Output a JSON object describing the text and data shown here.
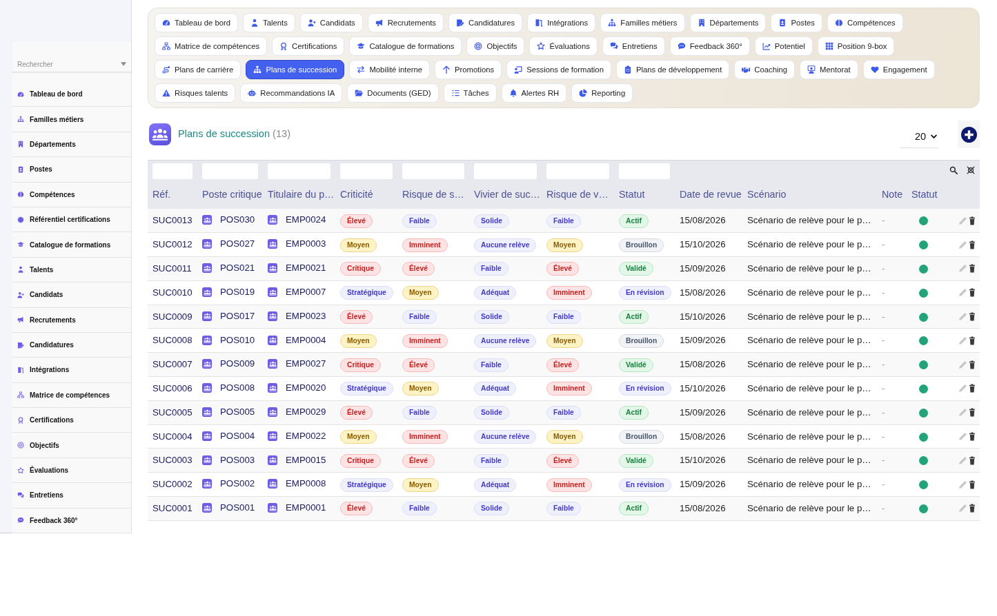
{
  "sidebar": {
    "search": {
      "placeholder": "Rechercher"
    },
    "items": [
      "Tableau de bord",
      "Familles métiers",
      "Départements",
      "Postes",
      "Compétences",
      "Référentiel certifications",
      "Catalogue de formations",
      "Talents",
      "Candidats",
      "Recrutements",
      "Candidatures",
      "Intégrations",
      "Matrice de compétences",
      "Certifications",
      "Objectifs",
      "Évaluations",
      "Entretiens",
      "Feedback 360°"
    ]
  },
  "nav": {
    "items": [
      {
        "label": "Tableau de bord",
        "selected": false
      },
      {
        "label": "Talents",
        "selected": false
      },
      {
        "label": "Candidats",
        "selected": false
      },
      {
        "label": "Recrutements",
        "selected": false
      },
      {
        "label": "Candidatures",
        "selected": false
      },
      {
        "label": "Intégrations",
        "selected": false
      },
      {
        "label": "Familles métiers",
        "selected": false
      },
      {
        "label": "Départements",
        "selected": false
      },
      {
        "label": "Postes",
        "selected": false
      },
      {
        "label": "Compétences",
        "selected": false
      },
      {
        "label": "Matrice de compétences",
        "selected": false
      },
      {
        "label": "Certifications",
        "selected": false
      },
      {
        "label": "Catalogue de formations",
        "selected": false
      },
      {
        "label": "Objectifs",
        "selected": false
      },
      {
        "label": "Évaluations",
        "selected": false
      },
      {
        "label": "Entretiens",
        "selected": false
      },
      {
        "label": "Feedback 360°",
        "selected": false
      },
      {
        "label": "Potentiel",
        "selected": false
      },
      {
        "label": "Position 9-box",
        "selected": false
      },
      {
        "label": "Plans de carrière",
        "selected": false
      },
      {
        "label": "Plans de succession",
        "selected": true
      },
      {
        "label": "Mobilité interne",
        "selected": false
      },
      {
        "label": "Promotions",
        "selected": false
      },
      {
        "label": "Sessions de formation",
        "selected": false
      },
      {
        "label": "Plans de développement",
        "selected": false
      },
      {
        "label": "Coaching",
        "selected": false
      },
      {
        "label": "Mentorat",
        "selected": false
      },
      {
        "label": "Engagement",
        "selected": false
      },
      {
        "label": "Risques talents",
        "selected": false
      },
      {
        "label": "Recommandations IA",
        "selected": false
      },
      {
        "label": "Documents (GED)",
        "selected": false
      },
      {
        "label": "Tâches",
        "selected": false
      },
      {
        "label": "Alertes RH",
        "selected": false
      },
      {
        "label": "Reporting",
        "selected": false
      }
    ]
  },
  "header": {
    "title": "Plans de succession",
    "count": "(13)",
    "page_size": "20"
  },
  "table": {
    "columns": [
      {
        "label": "Réf.",
        "filter": true
      },
      {
        "label": "Poste critique",
        "filter": true
      },
      {
        "label": "Titulaire du p…",
        "filter": true
      },
      {
        "label": "Criticité",
        "filter": true
      },
      {
        "label": "Risque de s…",
        "filter": true
      },
      {
        "label": "Vivier de suc…",
        "filter": true
      },
      {
        "label": "Risque de v…",
        "filter": true
      },
      {
        "label": "Statut",
        "filter": true
      },
      {
        "label": "Date de revue",
        "filter": false
      },
      {
        "label": "Scénario",
        "filter": false
      },
      {
        "label": "Note",
        "filter": false
      },
      {
        "label": "Statut",
        "filter": false
      }
    ],
    "rows": [
      {
        "cells": [
          {
            "kind": "ref",
            "text": "SUC0013"
          },
          {
            "kind": "record",
            "text": "POS030"
          },
          {
            "kind": "record",
            "text": "EMP0024"
          },
          {
            "kind": "badge",
            "text": "Élevé",
            "color": "#c81e1e"
          },
          {
            "kind": "badge",
            "text": "Faible",
            "color": "#4338ca"
          },
          {
            "kind": "badge",
            "text": "Solide",
            "color": "#4338ca"
          },
          {
            "kind": "badge",
            "text": "Faible",
            "color": "#4338ca"
          },
          {
            "kind": "badge",
            "text": "Actif",
            "color": "#15803d"
          },
          {
            "kind": "text",
            "text": "15/08/2026"
          },
          {
            "kind": "text",
            "text": "Scénario de relève pour le p…"
          },
          {
            "kind": "muted",
            "text": "-"
          },
          {
            "kind": "dot",
            "color": "#22a37a"
          }
        ]
      },
      {
        "cells": [
          {
            "kind": "ref",
            "text": "SUC0012"
          },
          {
            "kind": "record",
            "text": "POS027"
          },
          {
            "kind": "record",
            "text": "EMP0003"
          },
          {
            "kind": "badge",
            "text": "Moyen",
            "color": "#8a5a00"
          },
          {
            "kind": "badge",
            "text": "Imminent",
            "color": "#c81e1e"
          },
          {
            "kind": "badge",
            "text": "Aucune relève",
            "color": "#4338ca"
          },
          {
            "kind": "badge",
            "text": "Moyen",
            "color": "#8a5a00"
          },
          {
            "kind": "badge",
            "text": "Brouillon",
            "color": "#475569"
          },
          {
            "kind": "text",
            "text": "15/10/2026"
          },
          {
            "kind": "text",
            "text": "Scénario de relève pour le p…"
          },
          {
            "kind": "muted",
            "text": "-"
          },
          {
            "kind": "dot",
            "color": "#22a37a"
          }
        ]
      },
      {
        "cells": [
          {
            "kind": "ref",
            "text": "SUC0011"
          },
          {
            "kind": "record",
            "text": "POS021"
          },
          {
            "kind": "record",
            "text": "EMP0021"
          },
          {
            "kind": "badge",
            "text": "Critique",
            "color": "#c81e1e"
          },
          {
            "kind": "badge",
            "text": "Élevé",
            "color": "#c81e1e"
          },
          {
            "kind": "badge",
            "text": "Faible",
            "color": "#4338ca"
          },
          {
            "kind": "badge",
            "text": "Élevé",
            "color": "#c81e1e"
          },
          {
            "kind": "badge",
            "text": "Validé",
            "color": "#15803d"
          },
          {
            "kind": "text",
            "text": "15/09/2026"
          },
          {
            "kind": "text",
            "text": "Scénario de relève pour le p…"
          },
          {
            "kind": "muted",
            "text": "-"
          },
          {
            "kind": "dot",
            "color": "#22a37a"
          }
        ]
      },
      {
        "cells": [
          {
            "kind": "ref",
            "text": "SUC0010"
          },
          {
            "kind": "record",
            "text": "POS019"
          },
          {
            "kind": "record",
            "text": "EMP0007"
          },
          {
            "kind": "badge",
            "text": "Stratégique",
            "color": "#4338ca"
          },
          {
            "kind": "badge",
            "text": "Moyen",
            "color": "#8a5a00"
          },
          {
            "kind": "badge",
            "text": "Adéquat",
            "color": "#4338ca"
          },
          {
            "kind": "badge",
            "text": "Imminent",
            "color": "#c81e1e"
          },
          {
            "kind": "badge",
            "text": "En révision",
            "color": "#4338ca"
          },
          {
            "kind": "text",
            "text": "15/08/2026"
          },
          {
            "kind": "text",
            "text": "Scénario de relève pour le p…"
          },
          {
            "kind": "muted",
            "text": "-"
          },
          {
            "kind": "dot",
            "color": "#22a37a"
          }
        ]
      },
      {
        "cells": [
          {
            "kind": "ref",
            "text": "SUC0009"
          },
          {
            "kind": "record",
            "text": "POS017"
          },
          {
            "kind": "record",
            "text": "EMP0023"
          },
          {
            "kind": "badge",
            "text": "Élevé",
            "color": "#c81e1e"
          },
          {
            "kind": "badge",
            "text": "Faible",
            "color": "#4338ca"
          },
          {
            "kind": "badge",
            "text": "Solide",
            "color": "#4338ca"
          },
          {
            "kind": "badge",
            "text": "Faible",
            "color": "#4338ca"
          },
          {
            "kind": "badge",
            "text": "Actif",
            "color": "#15803d"
          },
          {
            "kind": "text",
            "text": "15/10/2026"
          },
          {
            "kind": "text",
            "text": "Scénario de relève pour le p…"
          },
          {
            "kind": "muted",
            "text": "-"
          },
          {
            "kind": "dot",
            "color": "#22a37a"
          }
        ]
      },
      {
        "cells": [
          {
            "kind": "ref",
            "text": "SUC0008"
          },
          {
            "kind": "record",
            "text": "POS010"
          },
          {
            "kind": "record",
            "text": "EMP0004"
          },
          {
            "kind": "badge",
            "text": "Moyen",
            "color": "#8a5a00"
          },
          {
            "kind": "badge",
            "text": "Imminent",
            "color": "#c81e1e"
          },
          {
            "kind": "badge",
            "text": "Aucune relève",
            "color": "#4338ca"
          },
          {
            "kind": "badge",
            "text": "Moyen",
            "color": "#8a5a00"
          },
          {
            "kind": "badge",
            "text": "Brouillon",
            "color": "#475569"
          },
          {
            "kind": "text",
            "text": "15/09/2026"
          },
          {
            "kind": "text",
            "text": "Scénario de relève pour le p…"
          },
          {
            "kind": "muted",
            "text": "-"
          },
          {
            "kind": "dot",
            "color": "#22a37a"
          }
        ]
      },
      {
        "cells": [
          {
            "kind": "ref",
            "text": "SUC0007"
          },
          {
            "kind": "record",
            "text": "POS009"
          },
          {
            "kind": "record",
            "text": "EMP0027"
          },
          {
            "kind": "badge",
            "text": "Critique",
            "color": "#c81e1e"
          },
          {
            "kind": "badge",
            "text": "Élevé",
            "color": "#c81e1e"
          },
          {
            "kind": "badge",
            "text": "Faible",
            "color": "#4338ca"
          },
          {
            "kind": "badge",
            "text": "Élevé",
            "color": "#c81e1e"
          },
          {
            "kind": "badge",
            "text": "Validé",
            "color": "#15803d"
          },
          {
            "kind": "text",
            "text": "15/08/2026"
          },
          {
            "kind": "text",
            "text": "Scénario de relève pour le p…"
          },
          {
            "kind": "muted",
            "text": "-"
          },
          {
            "kind": "dot",
            "color": "#22a37a"
          }
        ]
      },
      {
        "cells": [
          {
            "kind": "ref",
            "text": "SUC0006"
          },
          {
            "kind": "record",
            "text": "POS008"
          },
          {
            "kind": "record",
            "text": "EMP0020"
          },
          {
            "kind": "badge",
            "text": "Stratégique",
            "color": "#4338ca"
          },
          {
            "kind": "badge",
            "text": "Moyen",
            "color": "#8a5a00"
          },
          {
            "kind": "badge",
            "text": "Adéquat",
            "color": "#4338ca"
          },
          {
            "kind": "badge",
            "text": "Imminent",
            "color": "#c81e1e"
          },
          {
            "kind": "badge",
            "text": "En révision",
            "color": "#4338ca"
          },
          {
            "kind": "text",
            "text": "15/10/2026"
          },
          {
            "kind": "text",
            "text": "Scénario de relève pour le p…"
          },
          {
            "kind": "muted",
            "text": "-"
          },
          {
            "kind": "dot",
            "color": "#22a37a"
          }
        ]
      },
      {
        "cells": [
          {
            "kind": "ref",
            "text": "SUC0005"
          },
          {
            "kind": "record",
            "text": "POS005"
          },
          {
            "kind": "record",
            "text": "EMP0029"
          },
          {
            "kind": "badge",
            "text": "Élevé",
            "color": "#c81e1e"
          },
          {
            "kind": "badge",
            "text": "Faible",
            "color": "#4338ca"
          },
          {
            "kind": "badge",
            "text": "Solide",
            "color": "#4338ca"
          },
          {
            "kind": "badge",
            "text": "Faible",
            "color": "#4338ca"
          },
          {
            "kind": "badge",
            "text": "Actif",
            "color": "#15803d"
          },
          {
            "kind": "text",
            "text": "15/09/2026"
          },
          {
            "kind": "text",
            "text": "Scénario de relève pour le p…"
          },
          {
            "kind": "muted",
            "text": "-"
          },
          {
            "kind": "dot",
            "color": "#22a37a"
          }
        ]
      },
      {
        "cells": [
          {
            "kind": "ref",
            "text": "SUC0004"
          },
          {
            "kind": "record",
            "text": "POS004"
          },
          {
            "kind": "record",
            "text": "EMP0022"
          },
          {
            "kind": "badge",
            "text": "Moyen",
            "color": "#8a5a00"
          },
          {
            "kind": "badge",
            "text": "Imminent",
            "color": "#c81e1e"
          },
          {
            "kind": "badge",
            "text": "Aucune relève",
            "color": "#4338ca"
          },
          {
            "kind": "badge",
            "text": "Moyen",
            "color": "#8a5a00"
          },
          {
            "kind": "badge",
            "text": "Brouillon",
            "color": "#475569"
          },
          {
            "kind": "text",
            "text": "15/08/2026"
          },
          {
            "kind": "text",
            "text": "Scénario de relève pour le p…"
          },
          {
            "kind": "muted",
            "text": "-"
          },
          {
            "kind": "dot",
            "color": "#22a37a"
          }
        ]
      },
      {
        "cells": [
          {
            "kind": "ref",
            "text": "SUC0003"
          },
          {
            "kind": "record",
            "text": "POS003"
          },
          {
            "kind": "record",
            "text": "EMP0015"
          },
          {
            "kind": "badge",
            "text": "Critique",
            "color": "#c81e1e"
          },
          {
            "kind": "badge",
            "text": "Élevé",
            "color": "#c81e1e"
          },
          {
            "kind": "badge",
            "text": "Faible",
            "color": "#4338ca"
          },
          {
            "kind": "badge",
            "text": "Élevé",
            "color": "#c81e1e"
          },
          {
            "kind": "badge",
            "text": "Validé",
            "color": "#15803d"
          },
          {
            "kind": "text",
            "text": "15/10/2026"
          },
          {
            "kind": "text",
            "text": "Scénario de relève pour le p…"
          },
          {
            "kind": "muted",
            "text": "-"
          },
          {
            "kind": "dot",
            "color": "#22a37a"
          }
        ]
      },
      {
        "cells": [
          {
            "kind": "ref",
            "text": "SUC0002"
          },
          {
            "kind": "record",
            "text": "POS002"
          },
          {
            "kind": "record",
            "text": "EMP0008"
          },
          {
            "kind": "badge",
            "text": "Stratégique",
            "color": "#4338ca"
          },
          {
            "kind": "badge",
            "text": "Moyen",
            "color": "#8a5a00"
          },
          {
            "kind": "badge",
            "text": "Adéquat",
            "color": "#4338ca"
          },
          {
            "kind": "badge",
            "text": "Imminent",
            "color": "#c81e1e"
          },
          {
            "kind": "badge",
            "text": "En révision",
            "color": "#4338ca"
          },
          {
            "kind": "text",
            "text": "15/09/2026"
          },
          {
            "kind": "text",
            "text": "Scénario de relève pour le p…"
          },
          {
            "kind": "muted",
            "text": "-"
          },
          {
            "kind": "dot",
            "color": "#22a37a"
          }
        ]
      },
      {
        "cells": [
          {
            "kind": "ref",
            "text": "SUC0001"
          },
          {
            "kind": "record",
            "text": "POS001"
          },
          {
            "kind": "record",
            "text": "EMP0001"
          },
          {
            "kind": "badge",
            "text": "Élevé",
            "color": "#c81e1e"
          },
          {
            "kind": "badge",
            "text": "Faible",
            "color": "#4338ca"
          },
          {
            "kind": "badge",
            "text": "Solide",
            "color": "#4338ca"
          },
          {
            "kind": "badge",
            "text": "Faible",
            "color": "#4338ca"
          },
          {
            "kind": "badge",
            "text": "Actif",
            "color": "#15803d"
          },
          {
            "kind": "text",
            "text": "15/08/2026"
          },
          {
            "kind": "text",
            "text": "Scénario de relève pour le p…"
          },
          {
            "kind": "muted",
            "text": "-"
          },
          {
            "kind": "dot",
            "color": "#22a37a"
          }
        ]
      }
    ]
  }
}
